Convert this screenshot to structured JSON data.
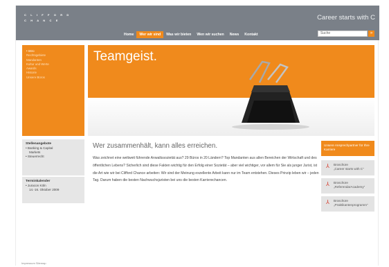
{
  "header": {
    "logo_lines": [
      "C L I F F O R D",
      "C H A N C E"
    ],
    "tagline": "Career starts with C",
    "nav": [
      {
        "label": "Home",
        "active": false
      },
      {
        "label": "Wer wir sind",
        "active": true
      },
      {
        "label": "Was wir bieten",
        "active": false
      },
      {
        "label": "Wen wir suchen",
        "active": false
      },
      {
        "label": "News",
        "active": false
      },
      {
        "label": "Kontakt",
        "active": false
      }
    ],
    "search_value": "Suche"
  },
  "leftnav": {
    "items": [
      {
        "label": "• Intro",
        "current": true
      },
      {
        "label": "Rechtsgebiete",
        "current": false
      },
      {
        "label": "Mandanten",
        "current": false
      },
      {
        "label": "Kultur und Werte",
        "current": false
      },
      {
        "label": "Awards",
        "current": false
      },
      {
        "label": "Historie",
        "current": false
      },
      {
        "label": "Unsere Büros",
        "current": false
      }
    ]
  },
  "hero": {
    "title": "Teamgeist."
  },
  "stellen": {
    "title": "Stellenangebote",
    "items": [
      "• Banking & Capital",
      "Markets",
      "• Steuerrecht"
    ]
  },
  "termine": {
    "title": "Terminkalender",
    "items": [
      "• Juracon Köln",
      "14.-16. Oktober 2009"
    ]
  },
  "main": {
    "title": "Wer zusammenhält, kann alles erreichen.",
    "body": "Was zeichnet eine weltweit führende Anwaltssozietät aus? 29 Büros in 20 Ländern? Top Mandanten aus allen Bereichen der Wirtschaft und des öffentlichen Lebens? Sicherlich sind diese Fakten wichtig für den Erfolg einer Sozietät – aber viel wichtiger, vor allem für Sie als junger Jurist, ist die Art wie wir bei Clifford Chance arbeiten: Wir sind der Meinung exzellente Arbeit kann nur im Team entstehen. Dieses Prinzip leben wir – jeden Tag. Darum haben die besten Nachwuchsjuristen bei uns die besten Karrierechancen."
  },
  "right": {
    "contact": "Unsere Ansprechpartner für Ihre Karriere",
    "brochures": [
      {
        "line1": "Broschüre",
        "line2": "„Career starts with C“"
      },
      {
        "line1": "Broschüre",
        "line2": "„ReferendarAcademy“"
      },
      {
        "line1": "Broschüre",
        "line2": "„Praktikantenprogramm“"
      }
    ],
    "pdf_icon": "pdf-icon"
  },
  "footer": {
    "text": "Impressum  Sitemap"
  },
  "colors": {
    "accent": "#f08a1c",
    "header": "#7a8088"
  }
}
